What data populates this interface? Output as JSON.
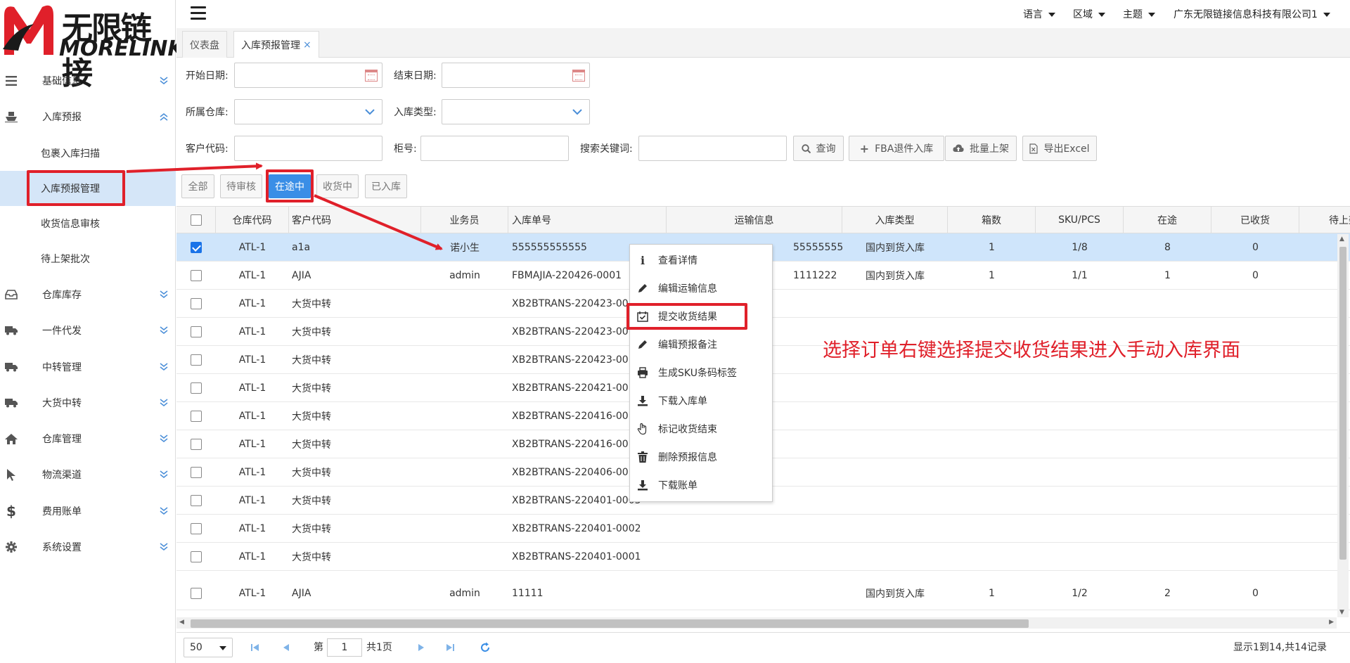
{
  "logo": {
    "cn": "无限链接",
    "en": "MORELINK"
  },
  "sidebar": {
    "items": [
      {
        "label": "基础信息",
        "icon": "list-icon"
      },
      {
        "label": "入库预报",
        "icon": "ship-icon"
      },
      {
        "label": "包裹入库扫描",
        "icon": ""
      },
      {
        "label": "入库预报管理",
        "icon": ""
      },
      {
        "label": "收货信息审核",
        "icon": ""
      },
      {
        "label": "待上架批次",
        "icon": ""
      },
      {
        "label": "仓库库存",
        "icon": "inbox-icon"
      },
      {
        "label": "一件代发",
        "icon": "truck-icon"
      },
      {
        "label": "中转管理",
        "icon": "truck-icon"
      },
      {
        "label": "大货中转",
        "icon": "truck-icon"
      },
      {
        "label": "仓库管理",
        "icon": "home-icon"
      },
      {
        "label": "物流渠道",
        "icon": "cursor-icon"
      },
      {
        "label": "费用账单",
        "icon": "dollar-icon"
      },
      {
        "label": "系统设置",
        "icon": "gear-icon"
      }
    ]
  },
  "topbar": {
    "language": "语言",
    "region": "区域",
    "theme": "主题",
    "company": "广东无限链接信息科技有限公司1"
  },
  "tabs": [
    {
      "label": "仪表盘"
    },
    {
      "label": "入库预报管理",
      "close": "×"
    }
  ],
  "filters": {
    "start_date": "开始日期:",
    "end_date": "结束日期:",
    "warehouse": "所属仓库:",
    "inbound_type": "入库类型:",
    "customer_code": "客户代码:",
    "cabinet_no": "柜号:",
    "keyword": "搜索关键词:"
  },
  "actions": {
    "query": "查询",
    "fba_return": "FBA退件入库",
    "batch_shelf": "批量上架",
    "export_excel": "导出Excel"
  },
  "status_filters": [
    "全部",
    "待审核",
    "在途中",
    "收货中",
    "已入库"
  ],
  "table": {
    "headers": [
      "仓库代码",
      "客户代码",
      "业务员",
      "入库单号",
      "运输信息",
      "入库类型",
      "箱数",
      "SKU/PCS",
      "在途",
      "已收货",
      "待上架"
    ],
    "rows": [
      {
        "wh": "ATL-1",
        "cust": "a1a",
        "sales": "诺小生",
        "order": "555555555555",
        "ship": "5555555555",
        "type": "国内到货入库",
        "boxes": "1",
        "sku": "1/8",
        "transit": "8",
        "recv": "0",
        "checked": true
      },
      {
        "wh": "ATL-1",
        "cust": "AJIA",
        "sales": "admin",
        "order": "FBMAJIA-220426-0001",
        "ship": "1111222",
        "type": "国内到货入库",
        "boxes": "1",
        "sku": "1/1",
        "transit": "1",
        "recv": "0",
        "checked": false
      },
      {
        "wh": "ATL-1",
        "cust": "大货中转",
        "sales": "",
        "order": "XB2BTRANS-220423-00",
        "ship": "",
        "type": "",
        "boxes": "",
        "sku": "",
        "transit": "",
        "recv": "",
        "checked": false
      },
      {
        "wh": "ATL-1",
        "cust": "大货中转",
        "sales": "",
        "order": "XB2BTRANS-220423-00",
        "ship": "",
        "type": "",
        "boxes": "",
        "sku": "",
        "transit": "",
        "recv": "",
        "checked": false
      },
      {
        "wh": "ATL-1",
        "cust": "大货中转",
        "sales": "",
        "order": "XB2BTRANS-220423-00",
        "ship": "",
        "type": "",
        "boxes": "",
        "sku": "",
        "transit": "",
        "recv": "",
        "checked": false
      },
      {
        "wh": "ATL-1",
        "cust": "大货中转",
        "sales": "",
        "order": "XB2BTRANS-220421-00",
        "ship": "",
        "type": "",
        "boxes": "",
        "sku": "",
        "transit": "",
        "recv": "",
        "checked": false
      },
      {
        "wh": "ATL-1",
        "cust": "大货中转",
        "sales": "",
        "order": "XB2BTRANS-220416-00",
        "ship": "",
        "type": "",
        "boxes": "",
        "sku": "",
        "transit": "",
        "recv": "",
        "checked": false
      },
      {
        "wh": "ATL-1",
        "cust": "大货中转",
        "sales": "",
        "order": "XB2BTRANS-220416-00",
        "ship": "",
        "type": "",
        "boxes": "",
        "sku": "",
        "transit": "",
        "recv": "",
        "checked": false
      },
      {
        "wh": "ATL-1",
        "cust": "大货中转",
        "sales": "",
        "order": "XB2BTRANS-220406-00",
        "ship": "",
        "type": "",
        "boxes": "",
        "sku": "",
        "transit": "",
        "recv": "",
        "checked": false
      },
      {
        "wh": "ATL-1",
        "cust": "大货中转",
        "sales": "",
        "order": "XB2BTRANS-220401-0003",
        "ship": "",
        "type": "",
        "boxes": "",
        "sku": "",
        "transit": "",
        "recv": "",
        "checked": false
      },
      {
        "wh": "ATL-1",
        "cust": "大货中转",
        "sales": "",
        "order": "XB2BTRANS-220401-0002",
        "ship": "",
        "type": "",
        "boxes": "",
        "sku": "",
        "transit": "",
        "recv": "",
        "checked": false
      },
      {
        "wh": "ATL-1",
        "cust": "大货中转",
        "sales": "",
        "order": "XB2BTRANS-220401-0001",
        "ship": "",
        "type": "",
        "boxes": "",
        "sku": "",
        "transit": "",
        "recv": "",
        "checked": false
      },
      {
        "wh": "ATL-1",
        "cust": "AJIA",
        "sales": "admin",
        "order": "11111",
        "ship": "",
        "type": "国内到货入库",
        "boxes": "1",
        "sku": "1/2",
        "transit": "2",
        "recv": "0",
        "checked": false
      }
    ]
  },
  "context_menu": {
    "items": [
      {
        "label": "查看详情",
        "icon": "info-icon"
      },
      {
        "label": "编辑运输信息",
        "icon": "pencil-icon"
      },
      {
        "label": "提交收货结果",
        "icon": "calendar-check-icon"
      },
      {
        "label": "编辑预报备注",
        "icon": "pencil-icon"
      },
      {
        "label": "生成SKU条码标签",
        "icon": "printer-icon"
      },
      {
        "label": "下载入库单",
        "icon": "download-icon"
      },
      {
        "label": "标记收货结束",
        "icon": "hand-icon"
      },
      {
        "label": "删除预报信息",
        "icon": "trash-icon"
      },
      {
        "label": "下载账单",
        "icon": "download-icon"
      }
    ]
  },
  "pager": {
    "page_size": "50",
    "page_prefix": "第",
    "page": "1",
    "page_total": "共1页",
    "summary": "显示1到14,共14记录"
  },
  "annotation": "选择订单右键选择提交收货结果进入手动入库界面",
  "colors": {
    "accent": "#3a8ee6",
    "selected_row": "#cfe5fb",
    "annotation_red": "#e0202a",
    "active_nav": "#d5e6f8"
  }
}
